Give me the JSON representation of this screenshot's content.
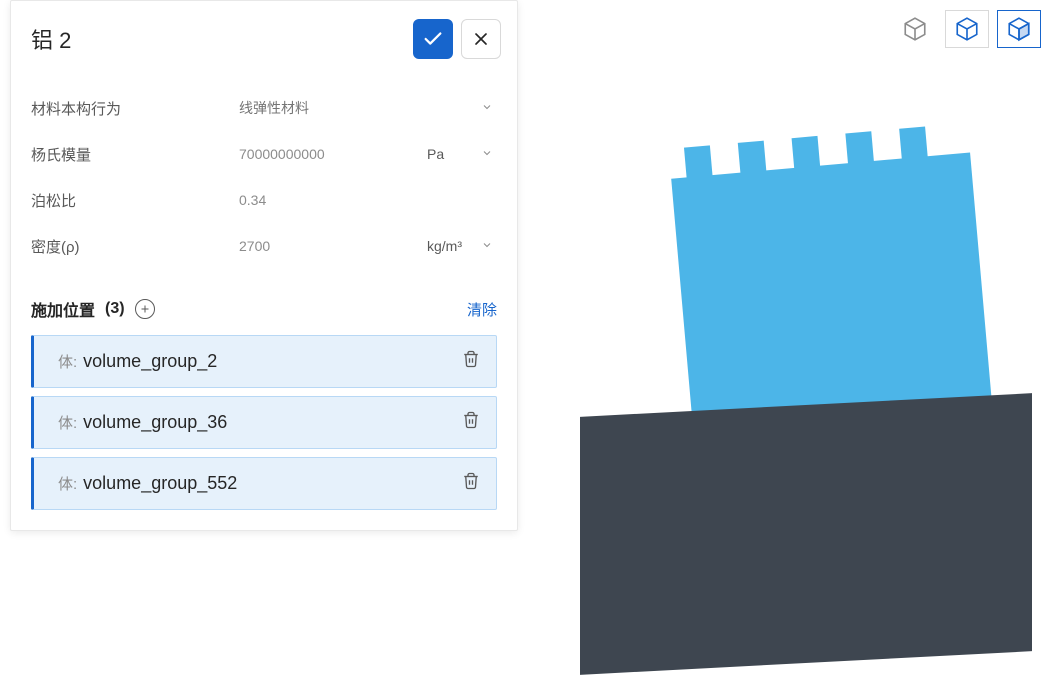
{
  "panel": {
    "title": "铝 2"
  },
  "props": {
    "behavior": {
      "label": "材料本构行为",
      "placeholder": "线弹性材料"
    },
    "youngs": {
      "label": "杨氏模量",
      "value": "70000000000",
      "unit": "Pa"
    },
    "poisson": {
      "label": "泊松比",
      "value": "0.34"
    },
    "density": {
      "label": "密度(ρ)",
      "value": "2700",
      "unit": "kg/m³"
    }
  },
  "assignment": {
    "title_prefix": "施加位置",
    "count": "(3)",
    "clear": "清除",
    "item_prefix": "体:",
    "items": [
      {
        "name": "volume_group_2"
      },
      {
        "name": "volume_group_36"
      },
      {
        "name": "volume_group_552"
      }
    ]
  }
}
